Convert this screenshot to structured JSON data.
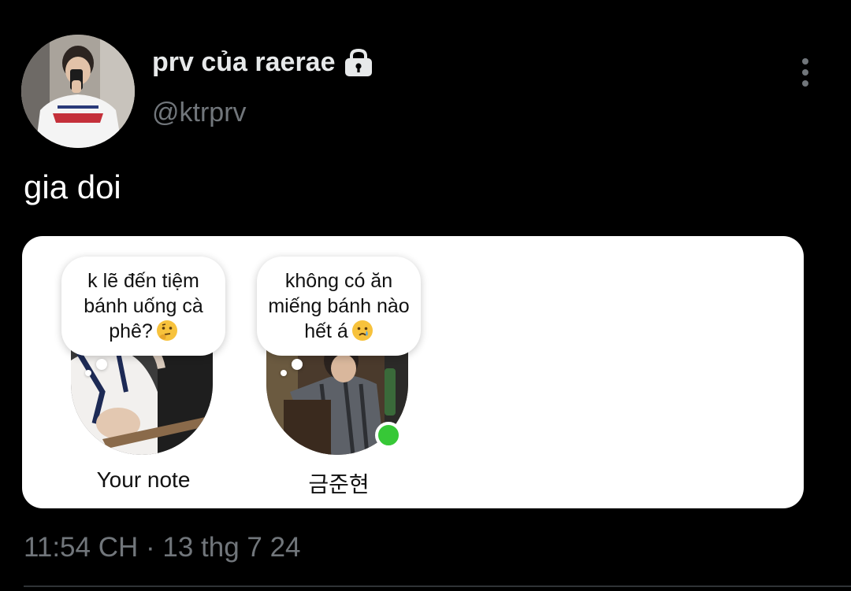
{
  "tweet": {
    "display_name": "prv của raerae",
    "handle": "@ktrprv",
    "text": "gia doi",
    "timestamp": "11:54 CH · 13 thg 7 24",
    "locked_icon": "lock-icon",
    "more_icon": "more-vertical-icon"
  },
  "notes_card": {
    "items": [
      {
        "note_text": "k lẽ đến tiệm bánh uống cà phê?",
        "emoji": "thinking-face-emoji",
        "name": "Your note"
      },
      {
        "note_text": "không có ăn miếng bánh nào hết á",
        "emoji": "crying-face-emoji",
        "name": "금준현",
        "online": true
      }
    ]
  },
  "colors": {
    "background": "#000000",
    "secondary_text": "#71767b",
    "online": "#37c837"
  }
}
